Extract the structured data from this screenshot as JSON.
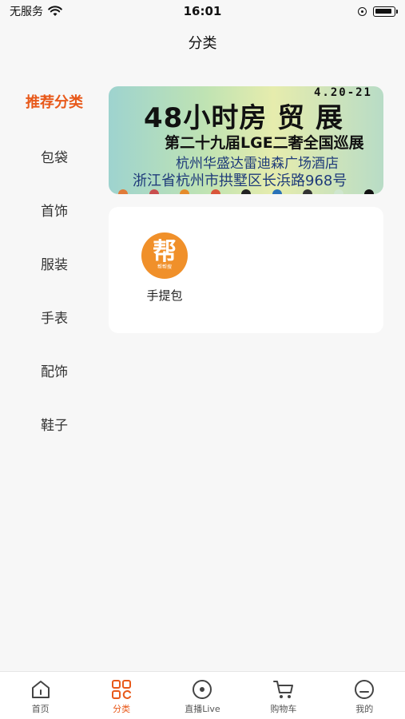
{
  "status_bar": {
    "carrier": "无服务",
    "time": "16:01"
  },
  "header": {
    "title": "分类"
  },
  "sidebar": {
    "items": [
      {
        "label": "推荐分类",
        "active": true
      },
      {
        "label": "包袋"
      },
      {
        "label": "首饰"
      },
      {
        "label": "服装"
      },
      {
        "label": "手表"
      },
      {
        "label": "配饰"
      },
      {
        "label": "鞋子"
      }
    ]
  },
  "banner": {
    "date": "4.20-21",
    "title": "48小时房 贸 展",
    "subtitle": "第二十九届LGE二奢全国巡展",
    "location_line1": "杭州华盛达雷迪森广场酒店",
    "location_line2": "浙江省杭州市拱墅区长浜路968号"
  },
  "categories": [
    {
      "label": "手提包",
      "logo_char": "帮",
      "logo_small_text": "帮帮搜",
      "icon": "bang-logo"
    }
  ],
  "tab_bar": {
    "tabs": [
      {
        "label": "首页",
        "icon": "home-icon"
      },
      {
        "label": "分类",
        "icon": "category-icon",
        "active": true
      },
      {
        "label": "直播Live",
        "icon": "live-icon"
      },
      {
        "label": "购物车",
        "icon": "cart-icon"
      },
      {
        "label": "我的",
        "icon": "profile-icon"
      }
    ]
  },
  "colors": {
    "accent": "#e8591a",
    "logo_orange": "#f0902a"
  }
}
